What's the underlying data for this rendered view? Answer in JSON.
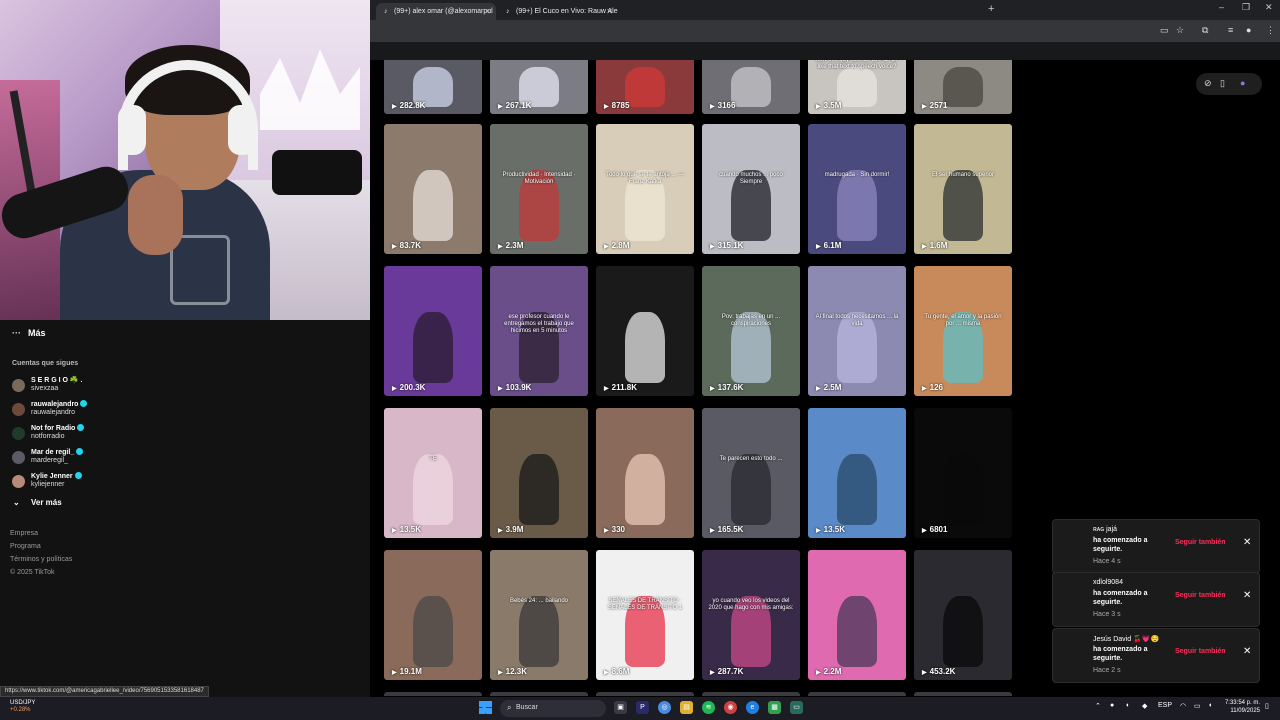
{
  "browser": {
    "tabs": [
      {
        "title": "(99+) alex omar (@alexomarpul"
      },
      {
        "title": "(99+) El Cuco en Vivo: Rauw Ale"
      }
    ],
    "new_tab": "+",
    "window_controls": [
      "–",
      "❐",
      "✕"
    ],
    "status_url": "https://www.tiktok.com/@americagabriellee_/video/7569051533581618487"
  },
  "sidebar": {
    "more_label": "Más",
    "following_header": "Cuentas que sigues",
    "accounts": [
      {
        "name": "S E R G I O ☘️ .",
        "handle": "sivexzaa",
        "verified": false,
        "color": "#7a6a5c"
      },
      {
        "name": "rauwalejandro",
        "handle": "rauwalejandro",
        "verified": true,
        "color": "#6c4b3a"
      },
      {
        "name": "Not for Radio",
        "handle": "notforradio",
        "verified": true,
        "color": "#1f3b2a"
      },
      {
        "name": "Mar de regil_",
        "handle": "marderegil_",
        "verified": true,
        "color": "#5b5b66"
      },
      {
        "name": "Kylie Jenner",
        "handle": "kyliejenner",
        "verified": true,
        "color": "#b88a78"
      }
    ],
    "see_more": "Ver más",
    "footer": [
      "Empresa",
      "Programa",
      "Términos y políticas",
      "© 2025 TikTok"
    ]
  },
  "grid": {
    "rows": [
      [
        {
          "views": "282.8K",
          "bg": "#5a5a64",
          "fig": "#cfd6ea",
          "caption": ""
        },
        {
          "views": "267.1K",
          "bg": "#7c7c84",
          "fig": "#e4e6f2",
          "caption": ""
        },
        {
          "views": "8785",
          "bg": "#8a3a3a",
          "fig": "#d23a3a",
          "caption": ""
        },
        {
          "views": "3166",
          "bg": "#6e6e74",
          "fig": "#c8c8cc",
          "caption": ""
        },
        {
          "views": "3.5M",
          "bg": "#c8c4c0",
          "fig": "#e8e4e0",
          "caption": "Why is no one talking about how this guy sounds EXACTLY like that text to speech voice?"
        },
        {
          "views": "2571",
          "bg": "#8c8a82",
          "fig": "#4a4640",
          "caption": ""
        }
      ],
      [
        {
          "views": "83.7K",
          "bg": "#8c7a6c",
          "fig": "#e8e0d8",
          "caption": ""
        },
        {
          "views": "2.3M",
          "bg": "#6a6e68",
          "fig": "#c23a3a",
          "caption": "Productividad · Intensidad · Motivación"
        },
        {
          "views": "2.8M",
          "bg": "#d8cdb8",
          "fig": "#efe6d4",
          "caption": "Todo lo que se te antoja ... —Franz Kafka"
        },
        {
          "views": "315.1K",
          "bg": "#bcbcc4",
          "fig": "#20202a",
          "caption": "cuando muchos ... poco Siempre"
        },
        {
          "views": "6.1M",
          "bg": "#4a4a7e",
          "fig": "#8e88c0",
          "caption": "madrugada · Sin dormir!"
        },
        {
          "views": "1.6M",
          "bg": "#c2b894",
          "fig": "#2a3030",
          "caption": "El ser humano superior"
        }
      ],
      [
        {
          "views": "200.3K",
          "bg": "#6a3a9a",
          "fig": "#2a1c30",
          "caption": ""
        },
        {
          "views": "103.9K",
          "bg": "#6a4e8a",
          "fig": "#2c2030",
          "caption": "ese profesor cuando le entregamos el trabajo que hicimos en 5 minutos"
        },
        {
          "views": "211.8K",
          "bg": "#1a1a1a",
          "fig": "#e8e8e8",
          "caption": ""
        },
        {
          "views": "137.6K",
          "bg": "#5c6a5c",
          "fig": "#b6c8d8",
          "caption": "Pov: trabajas en un ... conspiraciones"
        },
        {
          "views": "2.5M",
          "bg": "#8c8ab0",
          "fig": "#b8b4e0",
          "caption": "Al final todos necesitamos ... la vida"
        },
        {
          "views": "126",
          "bg": "#c88a5a",
          "fig": "#5cc0c8",
          "caption": "Tu gente, el amor y la pasión por ... misma"
        }
      ],
      [
        {
          "views": "13.5K",
          "bg": "#d8b8c8",
          "fig": "#f0d8e0",
          "caption": "TE"
        },
        {
          "views": "3.9M",
          "bg": "#6a5a48",
          "fig": "#1a1a1a",
          "caption": ""
        },
        {
          "views": "330",
          "bg": "#8a6a5a",
          "fig": "#e8c8b8",
          "caption": ""
        },
        {
          "views": "165.5K",
          "bg": "#5a5a64",
          "fig": "#2a2a30",
          "caption": "Te parecen esto todo ..."
        },
        {
          "views": "13.5K",
          "bg": "#5a8ac8",
          "fig": "#2a4a6a",
          "caption": ""
        },
        {
          "views": "6801",
          "bg": "#0a0a0a",
          "fig": "#0a0a0a",
          "caption": ""
        }
      ],
      [
        {
          "views": "19.1M",
          "bg": "#8a6a5a",
          "fig": "#4a4a4a",
          "caption": ""
        },
        {
          "views": "12.3K",
          "bg": "#8a7a6a",
          "fig": "#3a3a3a",
          "caption": "Bebés 24: ... bailando"
        },
        {
          "views": "8.6M",
          "bg": "#f0f0f0",
          "fig": "#e8314a",
          "caption": "SEÑALES DE TRÁNSITO · SEÑALES DE TRÁNSITO 1"
        },
        {
          "views": "287.7K",
          "bg": "#3a2a4a",
          "fig": "#c84a8a",
          "caption": "yo cuando veo los videos del 2020 que hago con mis amigas:"
        },
        {
          "views": "2.2M",
          "bg": "#e06ab0",
          "fig": "#4a3a5a",
          "caption": ""
        },
        {
          "views": "453.2K",
          "bg": "#2a2a30",
          "fig": "#0a0a0a",
          "caption": ""
        }
      ]
    ]
  },
  "notifications": [
    {
      "user": "ʀᴀԍ jajá",
      "message": "ha comenzado a seguirte.",
      "time": "Hace 4 s",
      "action": "Seguir también"
    },
    {
      "user": "xdlol9084",
      "message": "ha comenzado a seguirte.",
      "time": "Hace 3 s",
      "action": "Seguir también"
    },
    {
      "user": "Jesús David 🍒💗😌",
      "message": "ha comenzado a seguirte.",
      "time": "Hace 2 s",
      "action": "Seguir también"
    }
  ],
  "taskbar": {
    "stock_name": "USD/JPY",
    "stock_change": "+0.28%",
    "search_label": "Buscar",
    "language": "ESP",
    "time": "7:33:54 p. m.",
    "date": "11/09/2025"
  }
}
